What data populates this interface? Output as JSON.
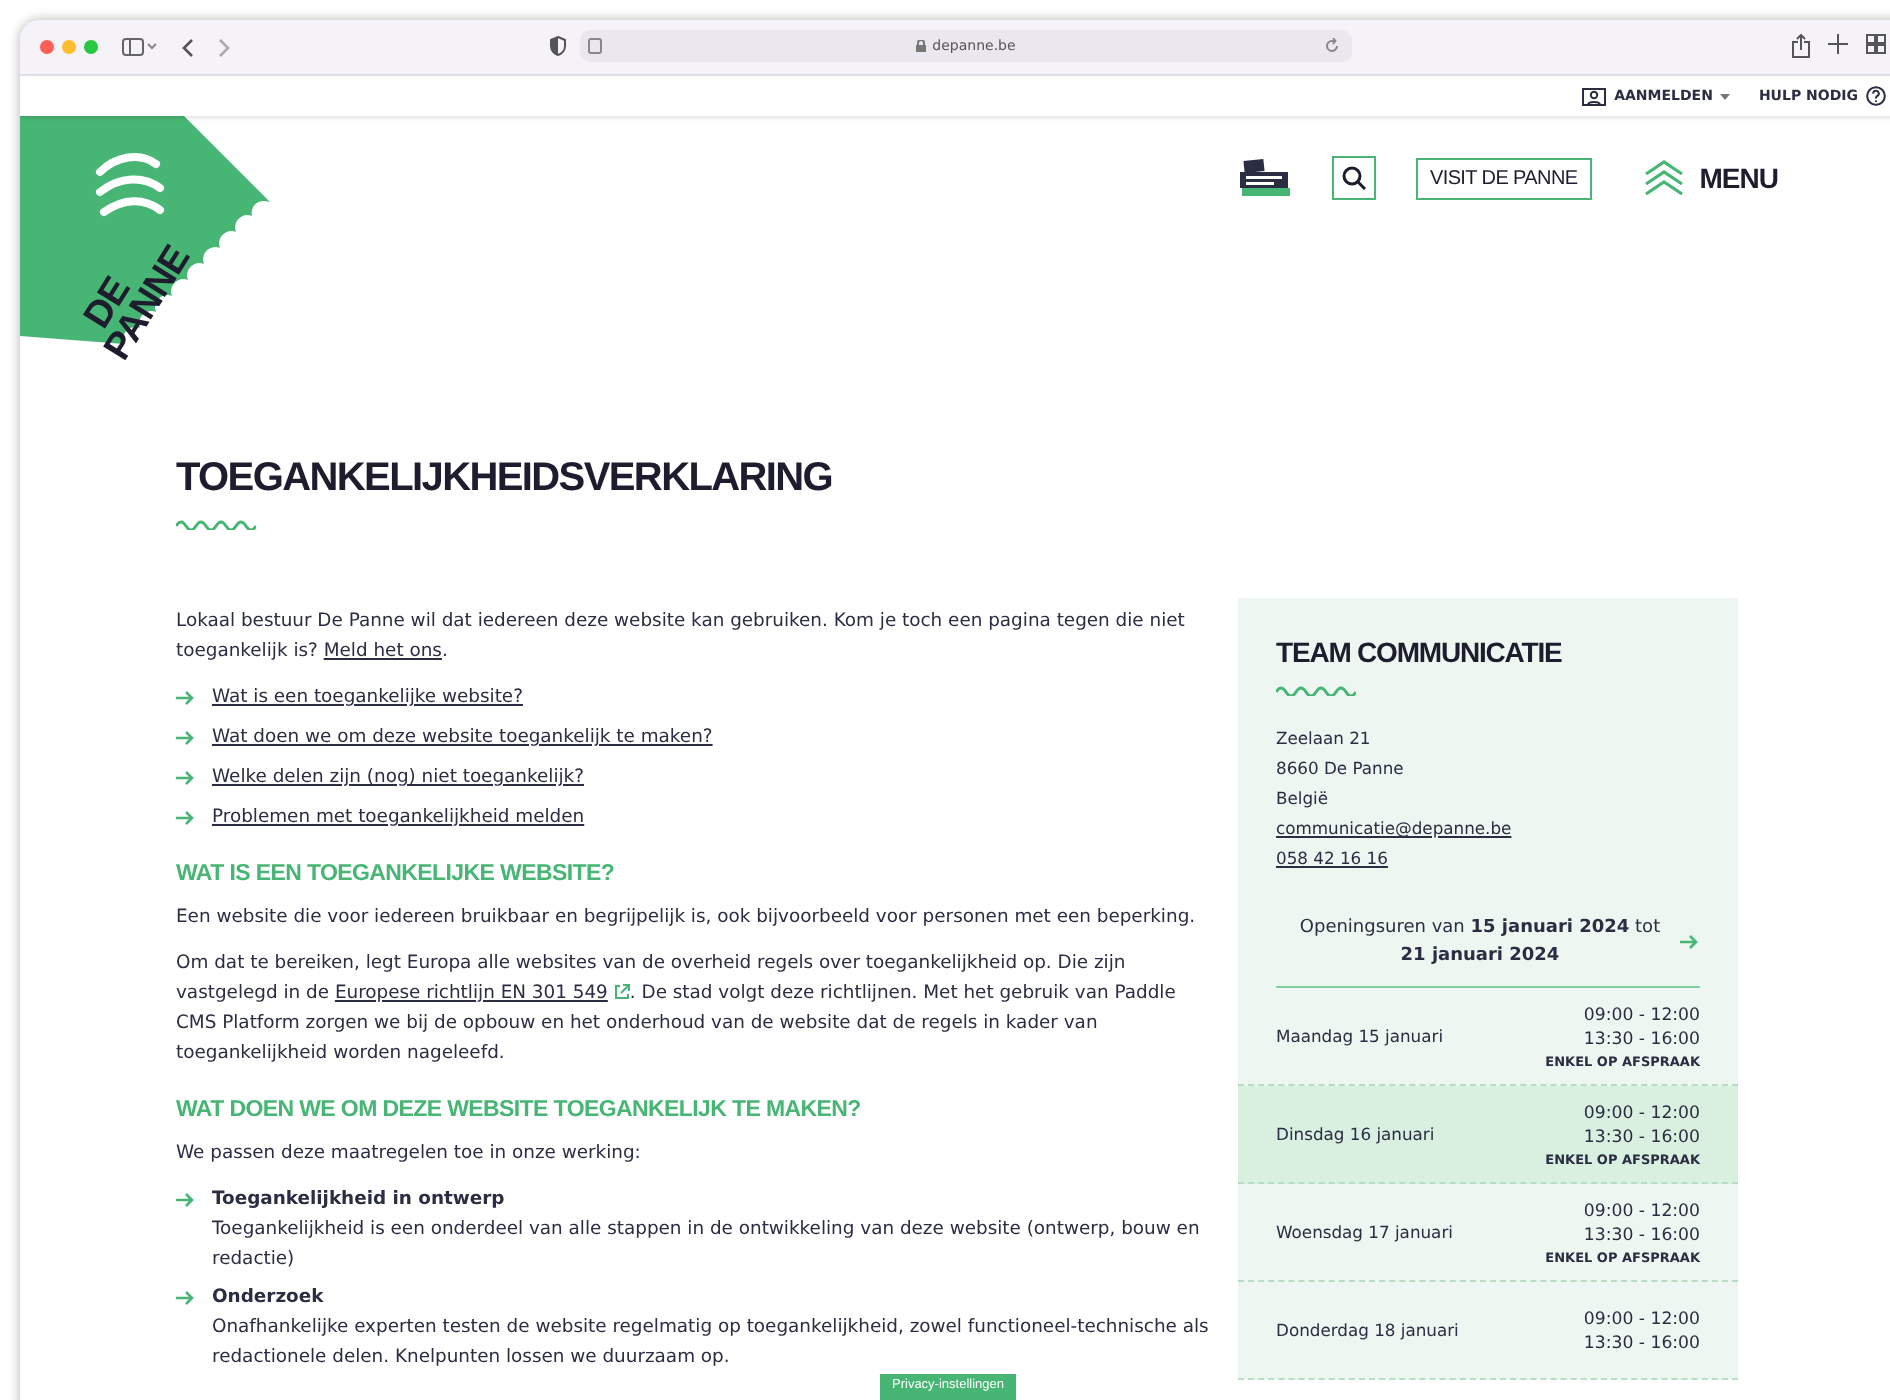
{
  "browser": {
    "url": "depanne.be"
  },
  "utility_bar": {
    "login": "AANMELDEN",
    "help": "HULP NODIG"
  },
  "logo": {
    "line1": "DE",
    "line2": "PANNE"
  },
  "nav": {
    "visit_button": "VISIT DE PANNE",
    "menu": "MENU"
  },
  "page_title": "TOEGANKELIJKHEIDSVERKLARING",
  "intro": {
    "text": "Lokaal bestuur De Panne wil dat iedereen deze website kan gebruiken. Kom je toch een pagina tegen die niet toegankelijk is? ",
    "link": "Meld het ons",
    "after": "."
  },
  "toc": [
    "Wat is een toegankelijke website?",
    "Wat doen we om deze website toegankelijk te maken?",
    "Welke delen zijn (nog) niet toegankelijk?",
    "Problemen met toegankelijkheid melden"
  ],
  "sections": [
    {
      "heading": "WAT IS EEN TOEGANKELIJKE WEBSITE?",
      "blocks": [
        {
          "kind": "paragraph",
          "text": "Een website die voor iedereen bruikbaar en begrijpelijk is, ook bijvoorbeeld voor personen met een beperking."
        },
        {
          "kind": "paragraph",
          "text": "Om dat te bereiken, legt Europa alle websites van de overheid regels over toegankelijkheid op. Die zijn vastgelegd in de ",
          "link": "Europese richtlijn EN 301 549",
          "external": true,
          "after": ". De stad volgt deze richtlijnen. Met het gebruik van Paddle CMS Platform zorgen we bij de opbouw en het onderhoud van de website dat de regels in kader van toegankelijkheid worden nageleefd."
        }
      ]
    },
    {
      "heading": "WAT DOEN WE OM DEZE WEBSITE TOEGANKELIJK TE MAKEN?",
      "blocks": [
        {
          "kind": "paragraph",
          "text": "We passen deze maatregelen toe in onze werking:"
        },
        {
          "kind": "measure",
          "title": "Toegankelijkheid in ontwerp",
          "text": "Toegankelijkheid is een onderdeel van alle stappen in de ontwikkeling van deze website (ontwerp, bouw en redactie)"
        },
        {
          "kind": "measure",
          "title": "Onderzoek",
          "text": "Onafhankelijke experten testen de website regelmatig op toegankelijkheid, zowel functioneel-technische als redactionele delen. Knelpunten lossen we duurzaam op."
        }
      ]
    }
  ],
  "contact": {
    "title": "TEAM COMMUNICATIE",
    "address": [
      "Zeelaan 21",
      "8660 De Panne",
      "België"
    ],
    "email": "communicatie@depanne.be",
    "phone": "058 42 16 16",
    "hours_link": "Openingsuren van **15 januari 2024** tot **21 januari 2024**",
    "hours": [
      {
        "day": "Maandag 15 januari",
        "times": [
          "09:00 - 12:00",
          "13:30 - 16:00"
        ],
        "note": "ENKEL OP AFSPRAAK",
        "selected": false
      },
      {
        "day": "Dinsdag 16 januari",
        "times": [
          "09:00 - 12:00",
          "13:30 - 16:00"
        ],
        "note": "ENKEL OP AFSPRAAK",
        "selected": true
      },
      {
        "day": "Woensdag 17 januari",
        "times": [
          "09:00 - 12:00",
          "13:30 - 16:00"
        ],
        "note": "ENKEL OP AFSPRAAK",
        "selected": false
      },
      {
        "day": "Donderdag 18 januari",
        "times": [
          "09:00 - 12:00",
          "13:30 - 16:00"
        ],
        "selected": false
      }
    ]
  },
  "privacy_button": "Privacy-instellingen"
}
